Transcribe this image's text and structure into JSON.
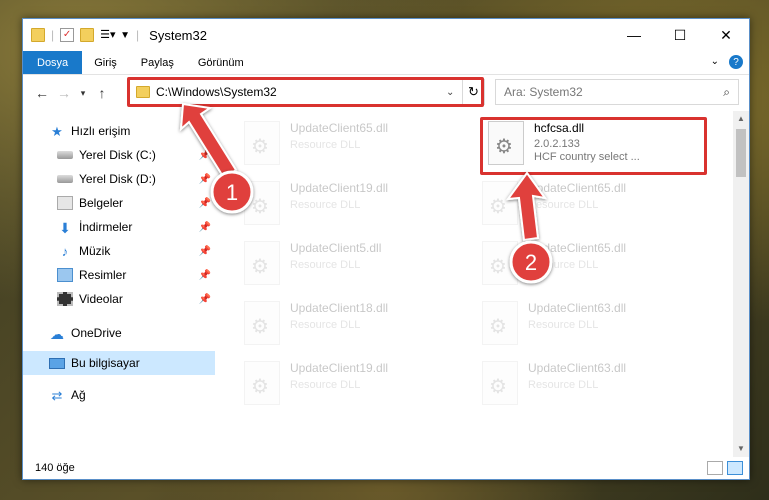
{
  "window": {
    "title": "System32"
  },
  "ribbon": {
    "tabs": [
      "Dosya",
      "Giriş",
      "Paylaş",
      "Görünüm"
    ]
  },
  "address": {
    "path": "C:\\Windows\\System32"
  },
  "search": {
    "placeholder": "Ara: System32"
  },
  "sidebar": {
    "items": [
      {
        "label": "Hızlı erişim",
        "icon": "star-icon"
      },
      {
        "label": "Yerel Disk (C:)",
        "icon": "drive-icon"
      },
      {
        "label": "Yerel Disk (D:)",
        "icon": "drive-icon"
      },
      {
        "label": "Belgeler",
        "icon": "documents-icon"
      },
      {
        "label": "İndirmeler",
        "icon": "download-icon"
      },
      {
        "label": "Müzik",
        "icon": "music-icon"
      },
      {
        "label": "Resimler",
        "icon": "pictures-icon"
      },
      {
        "label": "Videolar",
        "icon": "videos-icon"
      },
      {
        "label": "OneDrive",
        "icon": "cloud-icon"
      },
      {
        "label": "Bu bilgisayar",
        "icon": "computer-icon"
      },
      {
        "label": "Ağ",
        "icon": "network-icon"
      }
    ]
  },
  "files": {
    "main": {
      "name": "hcfcsa.dll",
      "version": "2.0.2.133",
      "description": "HCF country select ..."
    },
    "faded": [
      {
        "name": "UpdateClient65.dll",
        "desc": "Resource DLL"
      },
      {
        "name": "UpdateClient19.dll",
        "desc": "Resource DLL"
      },
      {
        "name": "UpdateClient5.dll",
        "desc": "Resource DLL"
      },
      {
        "name": "UpdateClient18.dll",
        "desc": "Resource DLL"
      },
      {
        "name": "UpdateClient19.dll",
        "desc": "Resource DLL"
      },
      {
        "name": "UpdateClient65.dll",
        "desc": "Resource DLL"
      },
      {
        "name": "UpdateClient65.dll",
        "desc": "Resource DLL"
      },
      {
        "name": "UpdateClient63.dll",
        "desc": "Resource DLL"
      },
      {
        "name": "UpdateClient63.dll",
        "desc": "Resource DLL"
      }
    ]
  },
  "status": {
    "count": "140 öğe"
  },
  "annotations": {
    "step1": "1",
    "step2": "2"
  },
  "colors": {
    "accent": "#1979ca",
    "annotation": "#d9322f",
    "selection": "#cce8ff"
  }
}
